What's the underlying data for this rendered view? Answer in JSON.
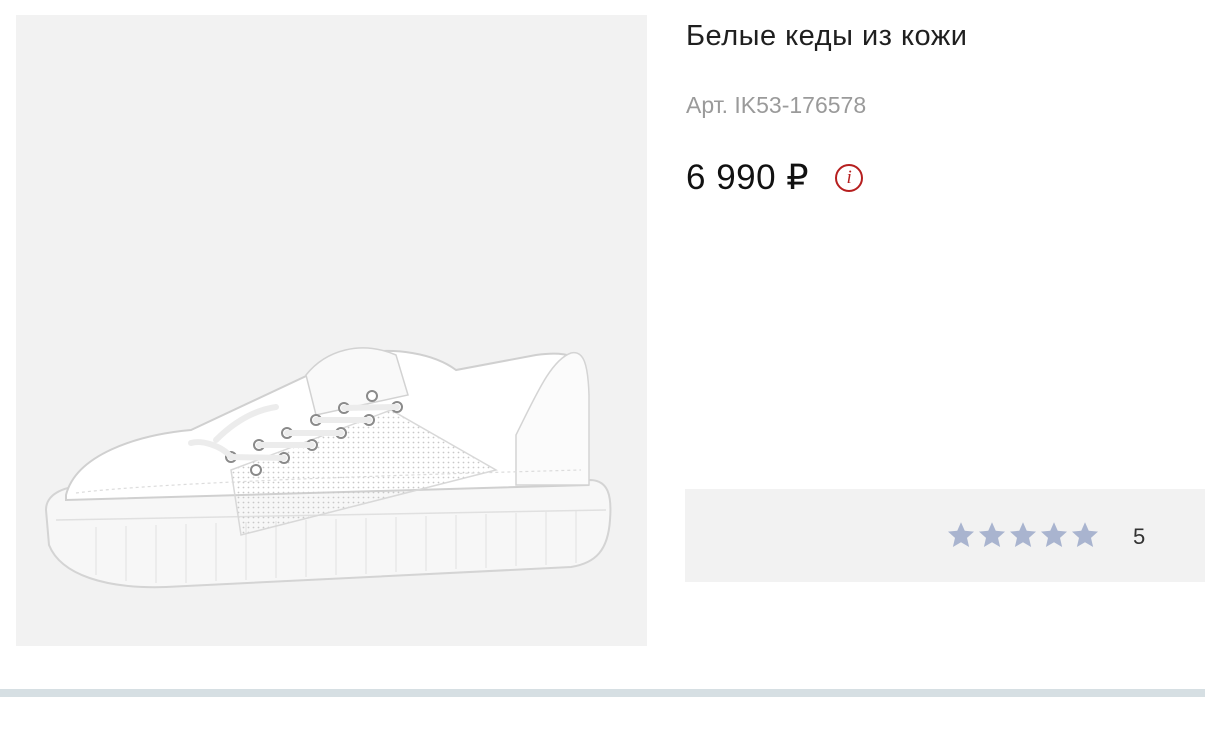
{
  "product": {
    "title": "Белые кеды из кожи",
    "sku": "Арт. IK53-176578",
    "price": "6 990 ₽",
    "info_icon": "info-circle-icon",
    "info_glyph": "i",
    "image": "white-leather-sneaker"
  },
  "rating": {
    "value": "5",
    "stars_total": 5,
    "stars_filled": 5,
    "star_color": "#a9b4cf"
  },
  "colors": {
    "accent": "#b61f1f",
    "panel_bg": "#f2f2f2",
    "divider": "#d6dfe3"
  }
}
